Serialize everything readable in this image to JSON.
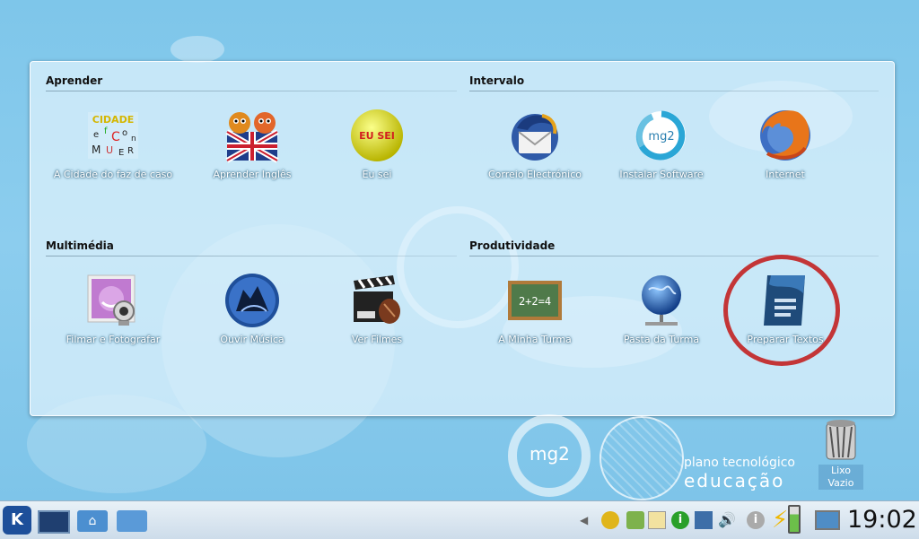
{
  "sections": [
    {
      "title": "Aprender",
      "apps": [
        {
          "label": "A Cidade do faz de caso",
          "icon": "cidade-icon"
        },
        {
          "label": "Aprender Inglês",
          "icon": "english-flag-icon"
        },
        {
          "label": "Eu sei",
          "icon": "eu-sei-ball-icon"
        }
      ]
    },
    {
      "title": "Intervalo",
      "apps": [
        {
          "label": "Correio Electrónico",
          "icon": "thunderbird-icon"
        },
        {
          "label": "Instalar Software",
          "icon": "mg2-install-icon"
        },
        {
          "label": "Internet",
          "icon": "firefox-icon"
        }
      ]
    },
    {
      "title": "Multimédia",
      "apps": [
        {
          "label": "Filmar e Fotografar",
          "icon": "webcam-icon"
        },
        {
          "label": "Ouvir Música",
          "icon": "music-wolf-icon"
        },
        {
          "label": "Ver Filmes",
          "icon": "film-clapper-icon"
        }
      ]
    },
    {
      "title": "Produtividade",
      "apps": [
        {
          "label": "A Minha Turma",
          "icon": "chalkboard-icon"
        },
        {
          "label": "Pasta da Turma",
          "icon": "network-globe-icon"
        },
        {
          "label": "Preparar Textos",
          "icon": "writer-document-icon"
        }
      ]
    }
  ],
  "eusei_text": "EU SEI",
  "cidade_text": "CIDADE",
  "chalk_text": "2+2=4",
  "mg2_text": "mg2",
  "branding": {
    "logo": "mg2",
    "line1": "plano tecnológico",
    "line2": "educação"
  },
  "trash": {
    "label": "Lixo Vazio"
  },
  "clock": "19:02",
  "taskbar": {
    "icons": [
      "kde-menu-icon",
      "desktop-show-icon",
      "home-folder-icon",
      "folder-icon"
    ]
  },
  "tray": {
    "icons": [
      "hide-arrow-icon",
      "updater-icon",
      "lock-icon",
      "clipboard-icon",
      "info-icon",
      "network-icon",
      "volume-icon",
      "notification-icon",
      "power-icon",
      "battery-icon",
      "screen-icon"
    ]
  }
}
